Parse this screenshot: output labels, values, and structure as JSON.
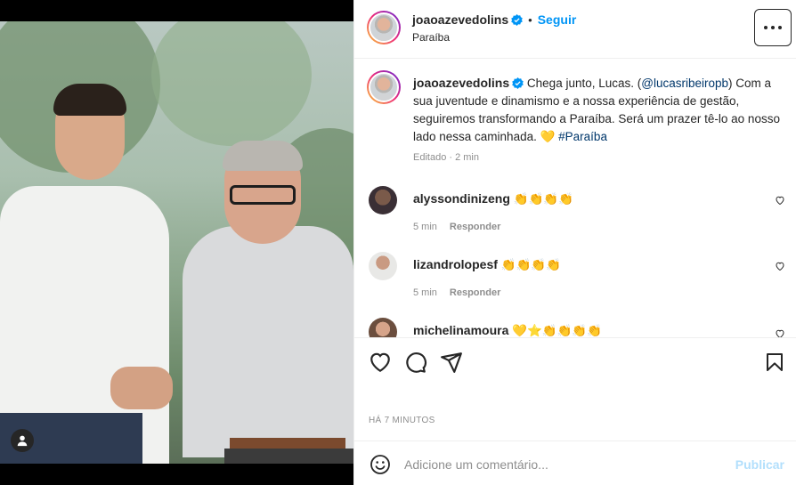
{
  "post": {
    "author": "joaoazevedolins",
    "separator": "•",
    "follow_label": "Seguir",
    "location": "Paraíba",
    "caption_text": "Chega junto, Lucas. (",
    "caption_mention": "@lucasribeiropb",
    "caption_rest": ") Com a sua juventude e dinamismo e a nossa experiência de gestão, seguiremos transformando a Paraíba. Será um prazer tê-lo ao nosso lado nessa caminhada. 💛 ",
    "caption_hashtag": "#Paraíba",
    "caption_meta": "Editado · 2 min",
    "posted_ago": "HÁ 7 MINUTOS"
  },
  "comments": [
    {
      "user": "alyssondinizeng",
      "text": "👏👏👏👏",
      "time": "5 min",
      "reply_label": "Responder"
    },
    {
      "user": "lizandrolopesf",
      "text": "👏👏👏👏",
      "time": "5 min",
      "reply_label": "Responder"
    },
    {
      "user": "michelinamoura",
      "text": "💛⭐👏👏👏👏",
      "time": "",
      "reply_label": ""
    }
  ],
  "add_comment": {
    "placeholder": "Adicione um comentário...",
    "publish_label": "Publicar"
  },
  "colors": {
    "accent": "#0095f6",
    "publish_disabled": "#b2dffc",
    "muted": "#8e8e8e"
  },
  "icons": [
    "user-tag-icon",
    "verified-icon",
    "more-options-icon",
    "like-icon",
    "comment-icon",
    "share-icon",
    "save-icon",
    "emoji-icon",
    "heart-small-icon"
  ]
}
